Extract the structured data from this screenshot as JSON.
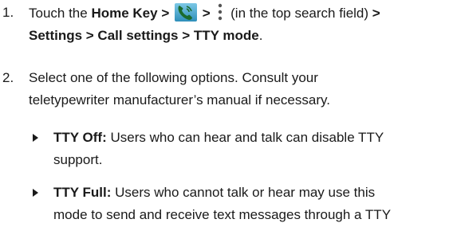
{
  "steps": [
    {
      "number": "1.",
      "line1": {
        "pre": "Touch the ",
        "home_key": "Home Key >",
        "sep": ">",
        "post": "(in the top search field)",
        "arrow": ">"
      },
      "line2": {
        "path": "Settings > Call settings > TTY mode",
        "end": "."
      },
      "icons": {
        "phone": "phone-app-icon",
        "menu": "menu-dots-icon"
      }
    },
    {
      "number": "2.",
      "line1": "Select one of the following options. Consult your",
      "line2": "teletypewriter manufacturer’s manual if necessary."
    }
  ],
  "options": [
    {
      "term": "TTY Off:",
      "line1": "Users who can hear and talk can disable TTY",
      "line2": "support."
    },
    {
      "term": "TTY Full:",
      "line1": "Users who cannot talk or hear may use this",
      "line2": "mode to send and receive text messages through a TTY"
    }
  ],
  "colors": {
    "text": "#1a1a1a",
    "phone_icon_bg": "#3aa0c8",
    "phone_handset": "#1b6b2e"
  }
}
